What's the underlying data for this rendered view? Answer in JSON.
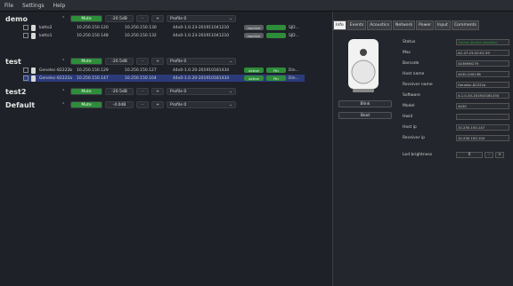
{
  "menu": [
    "File",
    "Settings",
    "Help"
  ],
  "groups": [
    {
      "name": "demo",
      "mute": "Mute",
      "volume": "-20.5dB",
      "minus": "-",
      "plus": "+",
      "profile": "Profile 0",
      "devices": [
        {
          "name": "katto2",
          "ip1": "10.250.150.120",
          "ip2": "10.250.150.130",
          "fw": "44x0-1.0.23-201911041210",
          "state": "Inactive",
          "power": "",
          "id": "SJD..."
        },
        {
          "name": "katto1",
          "ip1": "10.250.150.148",
          "ip2": "10.250.150.132",
          "fw": "44x0-1.0.23-201911041210",
          "state": "Inactive",
          "power": "",
          "id": "SJD..."
        }
      ]
    },
    {
      "name": "test",
      "mute": "Mute",
      "volume": "-20.5dB",
      "minus": "-",
      "plus": "+",
      "profile": "Profile 0",
      "devices": [
        {
          "name": "Genelec-82222b",
          "ip1": "10.250.150.129",
          "ip2": "10.250.150.127",
          "fw": "44x0-1.0.20-201910181434",
          "state": "Active",
          "power": "Pin",
          "id": "Din..."
        },
        {
          "name": "Genelec-82222a",
          "ip1": "10.250.150.147",
          "ip2": "10.250.150.104",
          "fw": "44x0-1.0.20-201910181434",
          "state": "Active",
          "power": "Pin",
          "id": "Din..."
        }
      ]
    },
    {
      "name": "test2",
      "mute": "Mute",
      "volume": "-20.5dB",
      "minus": "-",
      "plus": "+",
      "profile": "Profile 0",
      "devices": []
    },
    {
      "name": "Default",
      "mute": "Mute",
      "volume": "-4.0dB",
      "minus": "-",
      "plus": "+",
      "profile": "Profile 0",
      "devices": []
    }
  ],
  "tabs": [
    "Info",
    "Events",
    "Acoustics",
    "Network",
    "Power",
    "Input",
    "Comments"
  ],
  "side_buttons": {
    "blink": "Blink",
    "boot": "Boot"
  },
  "info": [
    {
      "label": "Status",
      "value": "Online (Active standby)",
      "green": true
    },
    {
      "label": "Mac",
      "value": "AC:47:23:20:01:39"
    },
    {
      "label": "Barcode",
      "value": "4436HM179"
    },
    {
      "label": "Host name",
      "value": "4430-20013B"
    },
    {
      "label": "Receiver name",
      "value": "Genelec-82222a"
    },
    {
      "label": "Software",
      "value": "4-1.0.20-201910181434"
    },
    {
      "label": "Model",
      "value": "4430"
    },
    {
      "label": "Hwid",
      "value": ""
    },
    {
      "label": "Host ip",
      "value": "10.250.150.147"
    },
    {
      "label": "Receiver ip",
      "value": "10.250.150.104"
    }
  ],
  "led": {
    "label": "Led brightness",
    "value": "0",
    "minus": "-",
    "plus": "+"
  }
}
